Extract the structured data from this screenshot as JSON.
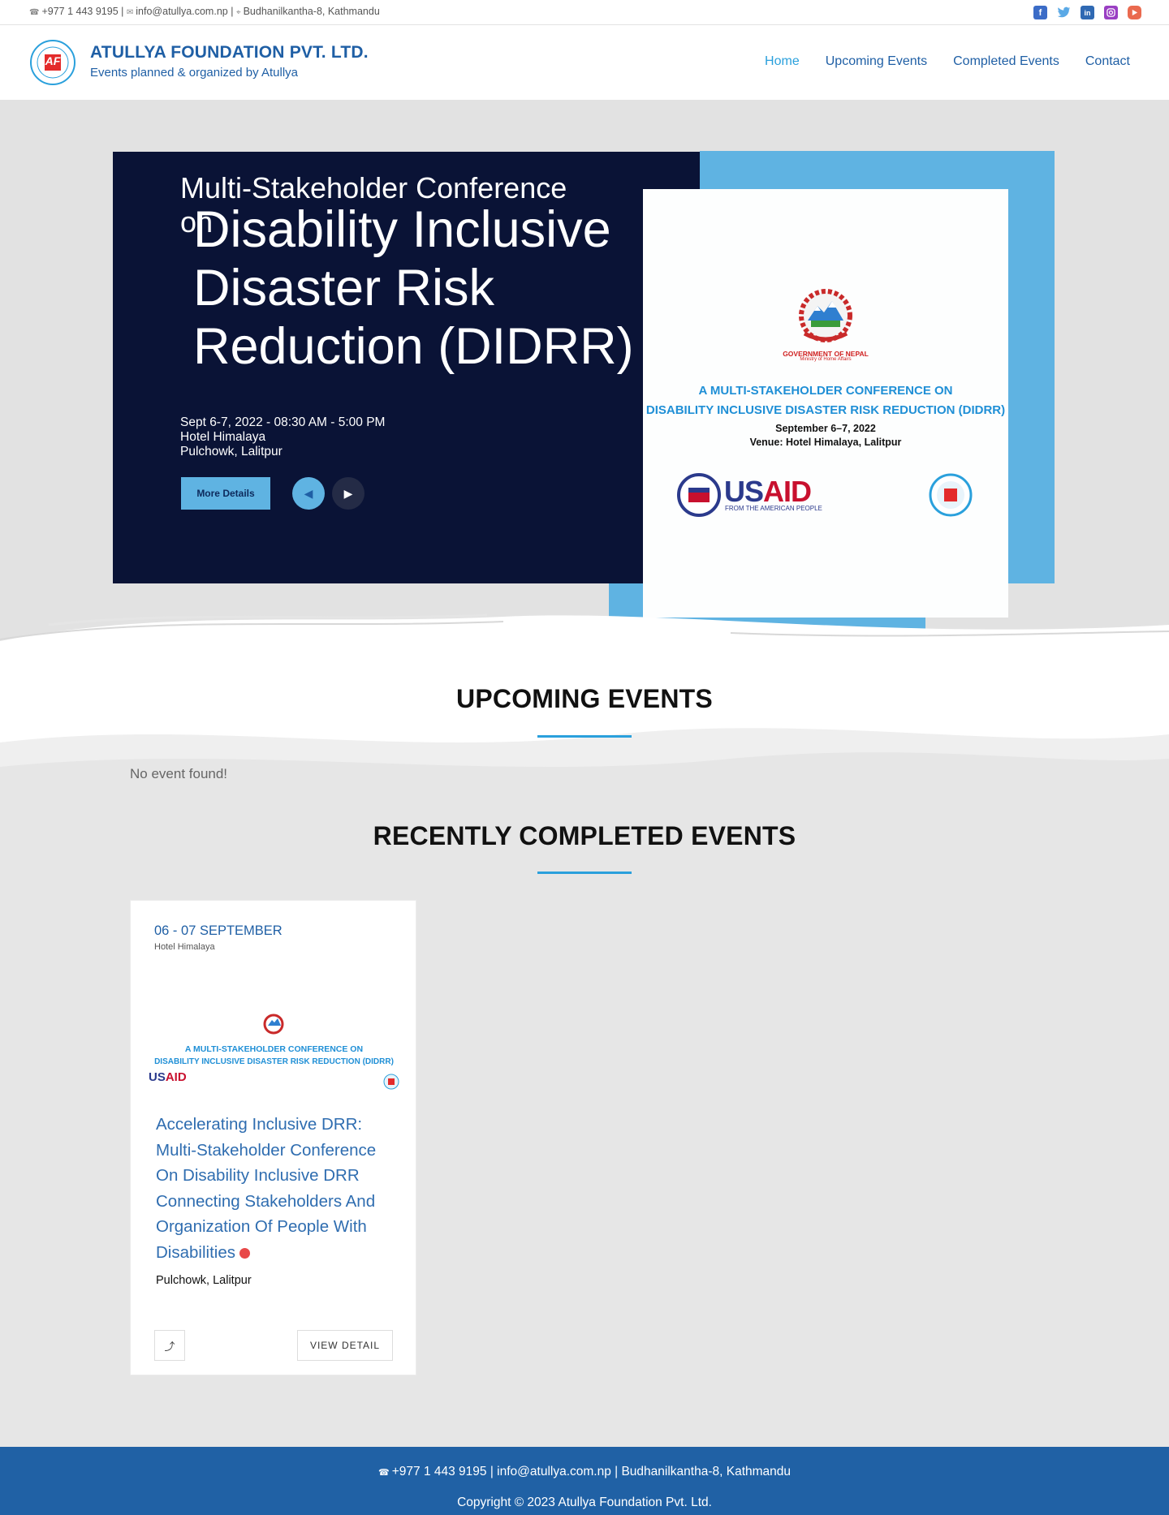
{
  "topbar": {
    "phone": "+977 1 443 9195",
    "email": "info@atullya.com.np",
    "address": "Budhanilkantha-8, Kathmandu",
    "separator": "|",
    "socials": [
      "facebook-icon",
      "twitter-icon",
      "linkedin-icon",
      "instagram-icon",
      "youtube-icon"
    ]
  },
  "header": {
    "logo_text": "AF",
    "logo_ring_text": "ATULLYA FOUNDATION",
    "title": "ATULLYA FOUNDATION PVT. LTD.",
    "subtitle": "Events planned & organized by Atullya",
    "nav": [
      {
        "label": "Home",
        "active": true
      },
      {
        "label": "Upcoming Events",
        "active": false
      },
      {
        "label": "Completed Events",
        "active": false
      },
      {
        "label": "Contact",
        "active": false
      }
    ]
  },
  "hero": {
    "small_title": "Multi-Stakeholder Conference on",
    "big_title": "Disability Inclusive Disaster Risk Reduction (DIDRR)",
    "meta_date": "Sept 6-7, 2022 - 08:30 AM - 5:00 PM",
    "meta_venue": "Hotel Himalaya",
    "meta_location": "Pulchowk, Lalitpur",
    "more_button": "More Details",
    "prev_icon": "◀",
    "next_icon": "▶",
    "poster": {
      "gov": "GOVERNMENT OF NEPAL",
      "ministry": "Ministry of Home Affairs",
      "line1": "A MULTI-STAKEHOLDER  CONFERENCE ON",
      "line2": "DISABILITY INCLUSIVE DISASTER RISK REDUCTION (DIDRR)",
      "date": "September 6–7, 2022",
      "venue": "Venue: Hotel Himalaya, Lalitpur",
      "usaid_us": "US",
      "usaid_aid": "AID",
      "usaid_sub": "FROM THE AMERICAN PEOPLE"
    }
  },
  "upcoming": {
    "heading": "UPCOMING EVENTS",
    "empty_text": "No event found!"
  },
  "completed": {
    "heading": "RECENTLY COMPLETED EVENTS",
    "cards": [
      {
        "date": "06 - 07 SEPTEMBER",
        "venue": "Hotel Himalaya",
        "image_line1": "A MULTI-STAKEHOLDER  CONFERENCE ON",
        "image_line2": "DISABILITY INCLUSIVE DISASTER RISK REDUCTION (DIDRR)",
        "title": "Accelerating Inclusive DRR: Multi-Stakeholder Conference On Disability Inclusive DRR Connecting Stakeholders And Organization Of People With Disabilities",
        "location": "Pulchowk, Lalitpur",
        "detail_button": "VIEW DETAIL"
      }
    ]
  },
  "footer": {
    "contact_line": "+977 1 443 9195 |  info@atullya.com.np |  Budhanilkantha-8, Kathmandu",
    "copyright": "Copyright © 2023 Atullya Foundation Pvt. Ltd."
  },
  "colors": {
    "brand_blue": "#1f5fa5",
    "accent": "#2aa0dc",
    "hero_dark": "#0a1336",
    "hero_light_blue": "#5fb3e2",
    "footer": "#2061a5"
  }
}
